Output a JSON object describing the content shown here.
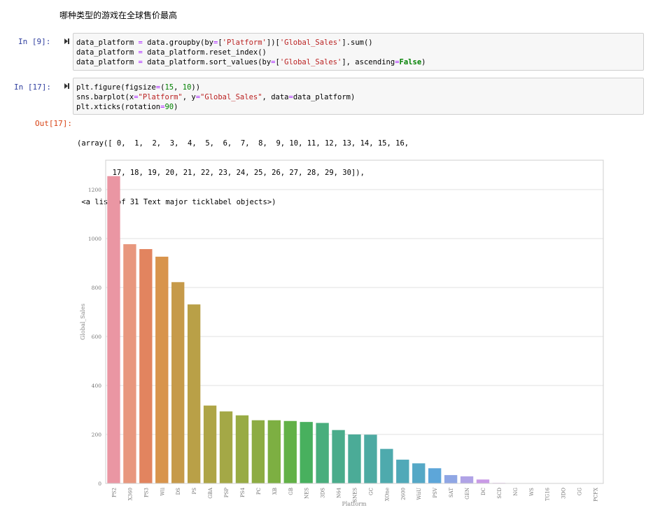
{
  "markdown": {
    "heading": "哪种类型的游戏在全球售价最高"
  },
  "cells": [
    {
      "prompt": "In  [9]:",
      "lines": [
        "data_platform = data.groupby(by=['Platform'])['Global_Sales'].sum()",
        "data_platform = data_platform.reset_index()",
        "data_platform = data_platform.sort_values(by=['Global_Sales'], ascending=False)"
      ]
    },
    {
      "prompt": "In  [17]:",
      "lines": [
        "plt.figure(figsize=(15, 10))",
        "sns.barplot(x=\"Platform\", y=\"Global_Sales\", data=data_platform)",
        "plt.xticks(rotation=90)"
      ]
    }
  ],
  "output": {
    "prompt": "Out[17]:",
    "lines": [
      "(array([ 0,  1,  2,  3,  4,  5,  6,  7,  8,  9, 10, 11, 12, 13, 14, 15, 16,",
      "        17, 18, 19, 20, 21, 22, 23, 24, 25, 26, 27, 28, 29, 30]),",
      " <a list of 31 Text major ticklabel objects>)"
    ]
  },
  "chart_data": {
    "type": "bar",
    "xlabel": "Platform",
    "ylabel": "Global_Sales",
    "ylim": [
      0,
      1320
    ],
    "yticks": [
      0,
      200,
      400,
      600,
      800,
      1000,
      1200
    ],
    "grid": "horizontal",
    "categories": [
      "PS2",
      "X360",
      "PS3",
      "Wii",
      "DS",
      "PS",
      "GBA",
      "PSP",
      "PS4",
      "PC",
      "XB",
      "GB",
      "NES",
      "3DS",
      "N64",
      "SNES",
      "GC",
      "XOne",
      "2600",
      "WiiU",
      "PSV",
      "SAT",
      "GEN",
      "DC",
      "SCD",
      "NG",
      "WS",
      "TG16",
      "3DO",
      "GG",
      "PCFX"
    ],
    "values": [
      1255,
      977,
      957,
      926,
      822,
      731,
      318,
      294,
      278,
      258,
      258,
      255,
      251,
      247,
      218,
      200,
      199,
      141,
      97,
      82,
      62,
      34,
      29,
      16,
      2,
      1,
      1,
      0.2,
      0.1,
      0.04,
      0.03
    ],
    "colors": [
      "#ea96a3",
      "#e8977e",
      "#e2845f",
      "#d8944c",
      "#c69a4a",
      "#b9a047",
      "#aea546",
      "#a4a846",
      "#98ab44",
      "#8dac43",
      "#7daf42",
      "#62b147",
      "#48b05e",
      "#49ae7d",
      "#4aac8b",
      "#4bab97",
      "#4daaa2",
      "#4eaaad",
      "#50a9b8",
      "#55a8c6",
      "#5da6d9",
      "#8fa6e4",
      "#b0a3e6",
      "#c99ae6",
      "#dc90e4",
      "#e58cd7",
      "#e88ec8",
      "#e98fba",
      "#e990ad",
      "#ea93a5",
      "#ea94a0"
    ]
  }
}
